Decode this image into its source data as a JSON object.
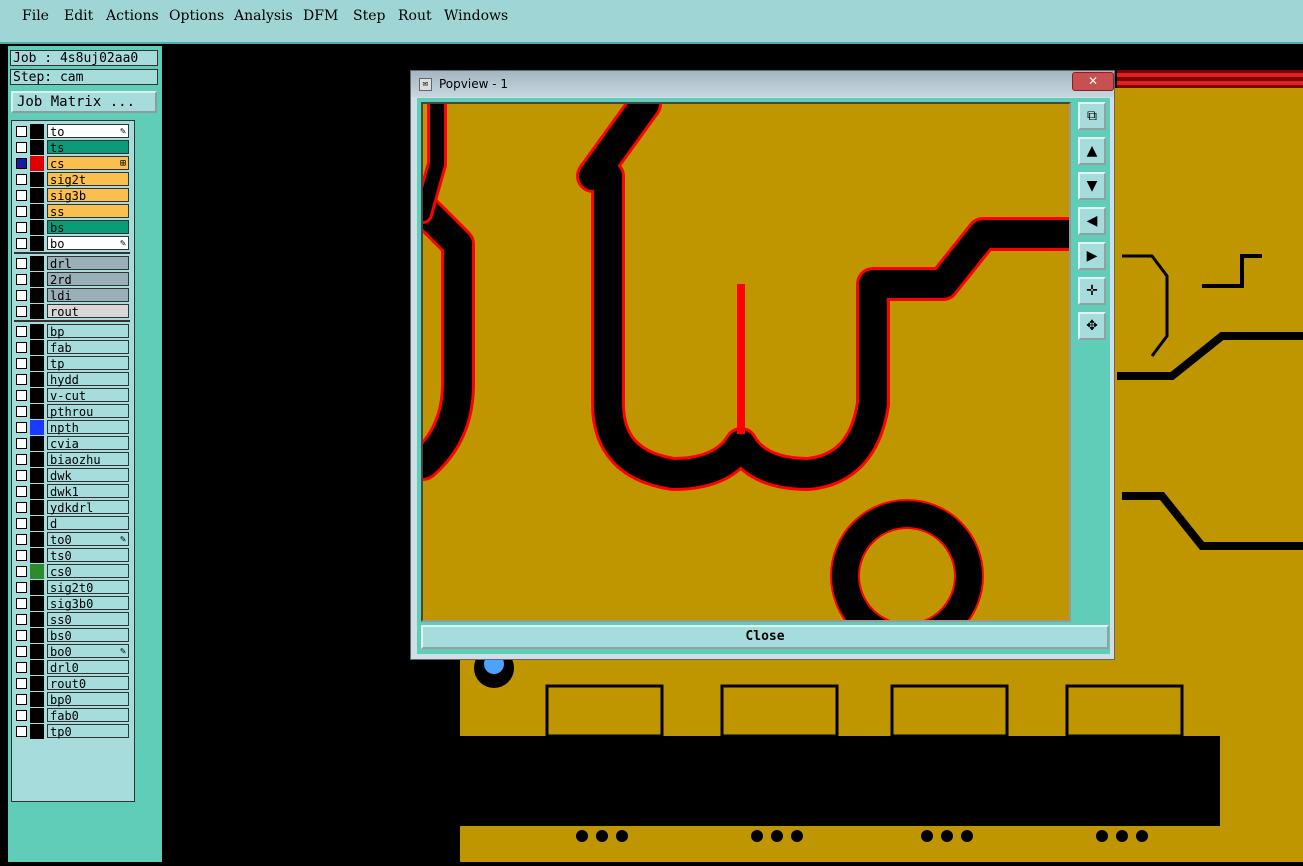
{
  "menu": [
    "File",
    "Edit",
    "Actions",
    "Options",
    "Analysis",
    "DFM",
    "Step",
    "Rout",
    "Windows"
  ],
  "job": "Job : 4s8uj02aa0",
  "step": "Step: cam",
  "job_matrix": "Job Matrix ...",
  "layers": [
    {
      "name": "to",
      "bg": "#ffffff",
      "tag": "✎"
    },
    {
      "name": "ts",
      "bg": "#0a9b78",
      "tag": ""
    },
    {
      "name": "cs",
      "bg": "#fbbf4f",
      "tag": "⊞",
      "sw": "#e00000",
      "cb": "#1a1aa0"
    },
    {
      "name": "sig2t",
      "bg": "#fbbf4f",
      "tag": ""
    },
    {
      "name": "sig3b",
      "bg": "#fbbf4f",
      "tag": ""
    },
    {
      "name": "ss",
      "bg": "#fbbf4f",
      "tag": ""
    },
    {
      "name": "bs",
      "bg": "#0a9b78",
      "tag": ""
    },
    {
      "name": "bo",
      "bg": "#ffffff",
      "tag": "✎"
    },
    {
      "name": "drl",
      "bg": "#9ab0b8",
      "tag": ""
    },
    {
      "name": "2rd",
      "bg": "#9ab0b8",
      "tag": ""
    },
    {
      "name": "ldi",
      "bg": "#9ab0b8",
      "tag": ""
    },
    {
      "name": "rout",
      "bg": "#d8d8d8",
      "tag": ""
    },
    {
      "name": "bp",
      "bg": "#a6dcdc",
      "tag": ""
    },
    {
      "name": "fab",
      "bg": "#a6dcdc",
      "tag": ""
    },
    {
      "name": "tp",
      "bg": "#a6dcdc",
      "tag": ""
    },
    {
      "name": "hydd",
      "bg": "#a6dcdc",
      "tag": ""
    },
    {
      "name": "v-cut",
      "bg": "#a6dcdc",
      "tag": ""
    },
    {
      "name": "pthrou",
      "bg": "#a6dcdc",
      "tag": ""
    },
    {
      "name": "npth",
      "bg": "#a6dcdc",
      "tag": "",
      "sw": "#1a3aff"
    },
    {
      "name": "cvia",
      "bg": "#a6dcdc",
      "tag": ""
    },
    {
      "name": "biaozhu",
      "bg": "#a6dcdc",
      "tag": ""
    },
    {
      "name": "dwk",
      "bg": "#a6dcdc",
      "tag": ""
    },
    {
      "name": "dwk1",
      "bg": "#a6dcdc",
      "tag": ""
    },
    {
      "name": "ydkdrl",
      "bg": "#a6dcdc",
      "tag": ""
    },
    {
      "name": "d",
      "bg": "#a6dcdc",
      "tag": ""
    },
    {
      "name": "to0",
      "bg": "#a6dcdc",
      "tag": "✎"
    },
    {
      "name": "ts0",
      "bg": "#a6dcdc",
      "tag": ""
    },
    {
      "name": "cs0",
      "bg": "#a6dcdc",
      "tag": "",
      "sw": "#2f8a2f"
    },
    {
      "name": "sig2t0",
      "bg": "#a6dcdc",
      "tag": ""
    },
    {
      "name": "sig3b0",
      "bg": "#a6dcdc",
      "tag": ""
    },
    {
      "name": "ss0",
      "bg": "#a6dcdc",
      "tag": ""
    },
    {
      "name": "bs0",
      "bg": "#a6dcdc",
      "tag": ""
    },
    {
      "name": "bo0",
      "bg": "#a6dcdc",
      "tag": "✎"
    },
    {
      "name": "drl0",
      "bg": "#a6dcdc",
      "tag": ""
    },
    {
      "name": "rout0",
      "bg": "#a6dcdc",
      "tag": ""
    },
    {
      "name": "bp0",
      "bg": "#a6dcdc",
      "tag": ""
    },
    {
      "name": "fab0",
      "bg": "#a6dcdc",
      "tag": ""
    },
    {
      "name": "tp0",
      "bg": "#a6dcdc",
      "tag": ""
    }
  ],
  "popview": {
    "title": "Popview - 1",
    "close_x": "✕",
    "close_label": "Close",
    "tools": [
      "zoom-fit-icon",
      "pan-up-icon",
      "pan-down-icon",
      "pan-left-icon",
      "pan-right-icon",
      "zoom-in-icon",
      "zoom-out-icon"
    ]
  },
  "colors": {
    "copper": "#c09600",
    "outline": "#ff0000",
    "panel": "#5fcdb7",
    "menubar": "#9fd5d5"
  }
}
